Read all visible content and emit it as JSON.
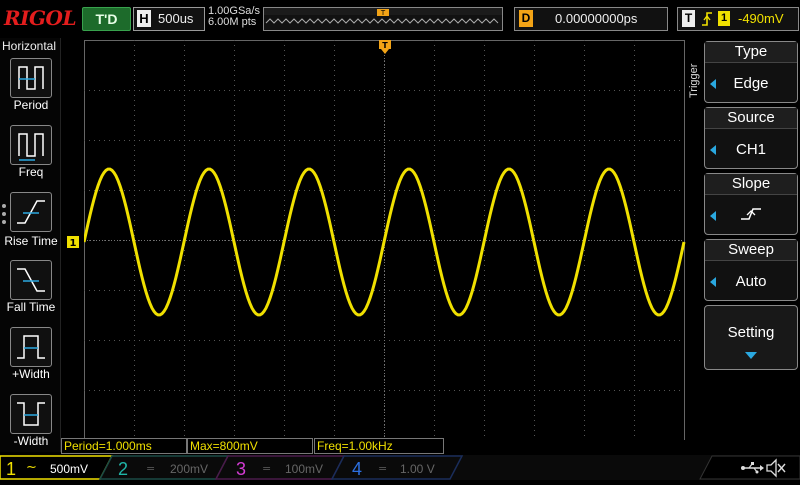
{
  "brand": "RIGOL",
  "top": {
    "run_status": "T'D",
    "horizontal_label": "H",
    "timebase": "500us",
    "sample_rate": "1.00GSa/s",
    "memory_depth": "6.00M pts",
    "delay_label": "D",
    "delay_value": "0.00000000ps",
    "trigger_label": "T",
    "trigger_channel": "1",
    "trigger_level": "-490mV"
  },
  "left_menu": {
    "title": "Horizontal",
    "items": [
      {
        "label": "Period"
      },
      {
        "label": "Freq"
      },
      {
        "label": "Rise Time"
      },
      {
        "label": "Fall Time"
      },
      {
        "label": "+Width"
      },
      {
        "label": "-Width"
      }
    ]
  },
  "trigger_menu": {
    "section_label": "Trigger",
    "type": {
      "title": "Type",
      "value": "Edge"
    },
    "source": {
      "title": "Source",
      "value": "CH1"
    },
    "slope": {
      "title": "Slope"
    },
    "sweep": {
      "title": "Sweep",
      "value": "Auto"
    },
    "setting": {
      "title": "Setting"
    }
  },
  "measurements": [
    "Period=1.000ms",
    "Max=800mV",
    "Freq=1.00kHz"
  ],
  "channels": [
    {
      "num": "1",
      "scale": "500mV",
      "color": "#f0e000",
      "active": true
    },
    {
      "num": "2",
      "scale": "200mV",
      "color": "#1fb5a8",
      "active": false
    },
    {
      "num": "3",
      "scale": "100mV",
      "color": "#d43bd4",
      "active": false
    },
    {
      "num": "4",
      "scale": "1.00 V",
      "color": "#2c6fe0",
      "active": false
    }
  ],
  "waveform": {
    "cycles": 6,
    "color": "#f0e000"
  },
  "colors": {
    "ch1": "#f0e000",
    "trigger_marker": "#f2a316",
    "accent": "#2aa8e0",
    "brand": "#e31d1d"
  }
}
